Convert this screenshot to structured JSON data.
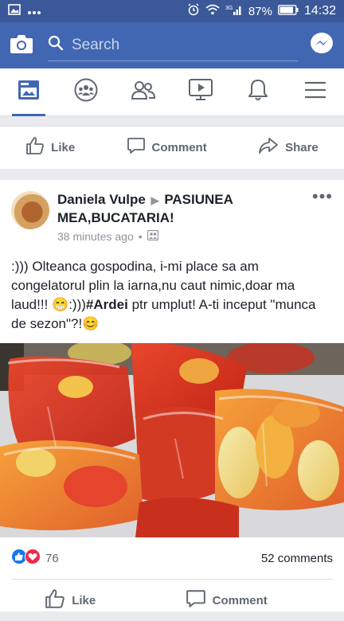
{
  "status_bar": {
    "battery": "87%",
    "time": "14:32"
  },
  "app_bar": {
    "search_placeholder": "Search"
  },
  "nav_tabs": [
    "news-feed",
    "groups",
    "friends",
    "watch",
    "notifications",
    "menu"
  ],
  "prev_post_actions": {
    "like": "Like",
    "comment": "Comment",
    "share": "Share"
  },
  "post": {
    "author": "Daniela Vulpe",
    "separator": "▶",
    "group": "PASIUNEA MEA,BUCATARIA!",
    "time": "38 minutes ago",
    "text_before": ":))) Olteanca gospodina, i-mi place sa am congelatorul plin la iarna,nu caut nimic,doar ma laud!!! 😁:)))",
    "hashtag": "#Ardei",
    "text_after": " ptr umplut! A-ti inceput \"munca de sezon\"?!😊",
    "reaction_count": "76",
    "comment_count": "52 comments",
    "actions": {
      "like": "Like",
      "comment": "Comment"
    }
  },
  "colors": {
    "brand": "#4267b2",
    "status_bar": "#3b5998",
    "like_blue": "#1877f2",
    "love_red": "#f02849"
  }
}
